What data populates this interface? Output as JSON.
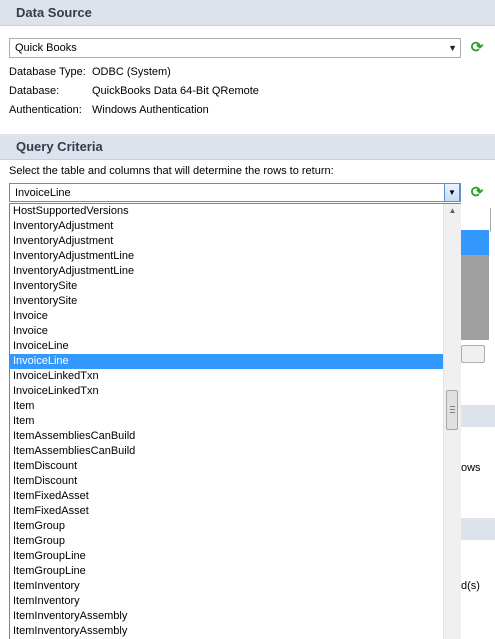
{
  "data_source": {
    "header": "Data Source",
    "source_combo": "Quick Books",
    "database_type_label": "Database Type:",
    "database_type_value": "ODBC (System)",
    "database_label": "Database:",
    "database_value": "QuickBooks Data 64-Bit QRemote",
    "authentication_label": "Authentication:",
    "authentication_value": "Windows Authentication"
  },
  "query_criteria": {
    "header": "Query Criteria",
    "instruction": "Select the table and columns that will determine the rows to return:",
    "table_combo": "InvoiceLine"
  },
  "table_list": {
    "items": [
      "HostSupportedVersions",
      "InventoryAdjustment",
      "InventoryAdjustment",
      "InventoryAdjustmentLine",
      "InventoryAdjustmentLine",
      "InventorySite",
      "InventorySite",
      "Invoice",
      "Invoice",
      "InvoiceLine",
      "InvoiceLine",
      "InvoiceLinkedTxn",
      "InvoiceLinkedTxn",
      "Item",
      "Item",
      "ItemAssembliesCanBuild",
      "ItemAssembliesCanBuild",
      "ItemDiscount",
      "ItemDiscount",
      "ItemFixedAsset",
      "ItemFixedAsset",
      "ItemGroup",
      "ItemGroup",
      "ItemGroupLine",
      "ItemGroupLine",
      "ItemInventory",
      "ItemInventory",
      "ItemInventoryAssembly",
      "ItemInventoryAssembly"
    ],
    "selected_index": 10
  },
  "background": {
    "partial_text_1": "ows",
    "partial_text_2": "d(s)"
  },
  "icons": {
    "refresh": "refresh-icon",
    "dropdown": "chevron-down-icon"
  },
  "colors": {
    "section_header": "#dde3ec",
    "selection": "#3399ff",
    "refresh": "#2aa12a"
  }
}
